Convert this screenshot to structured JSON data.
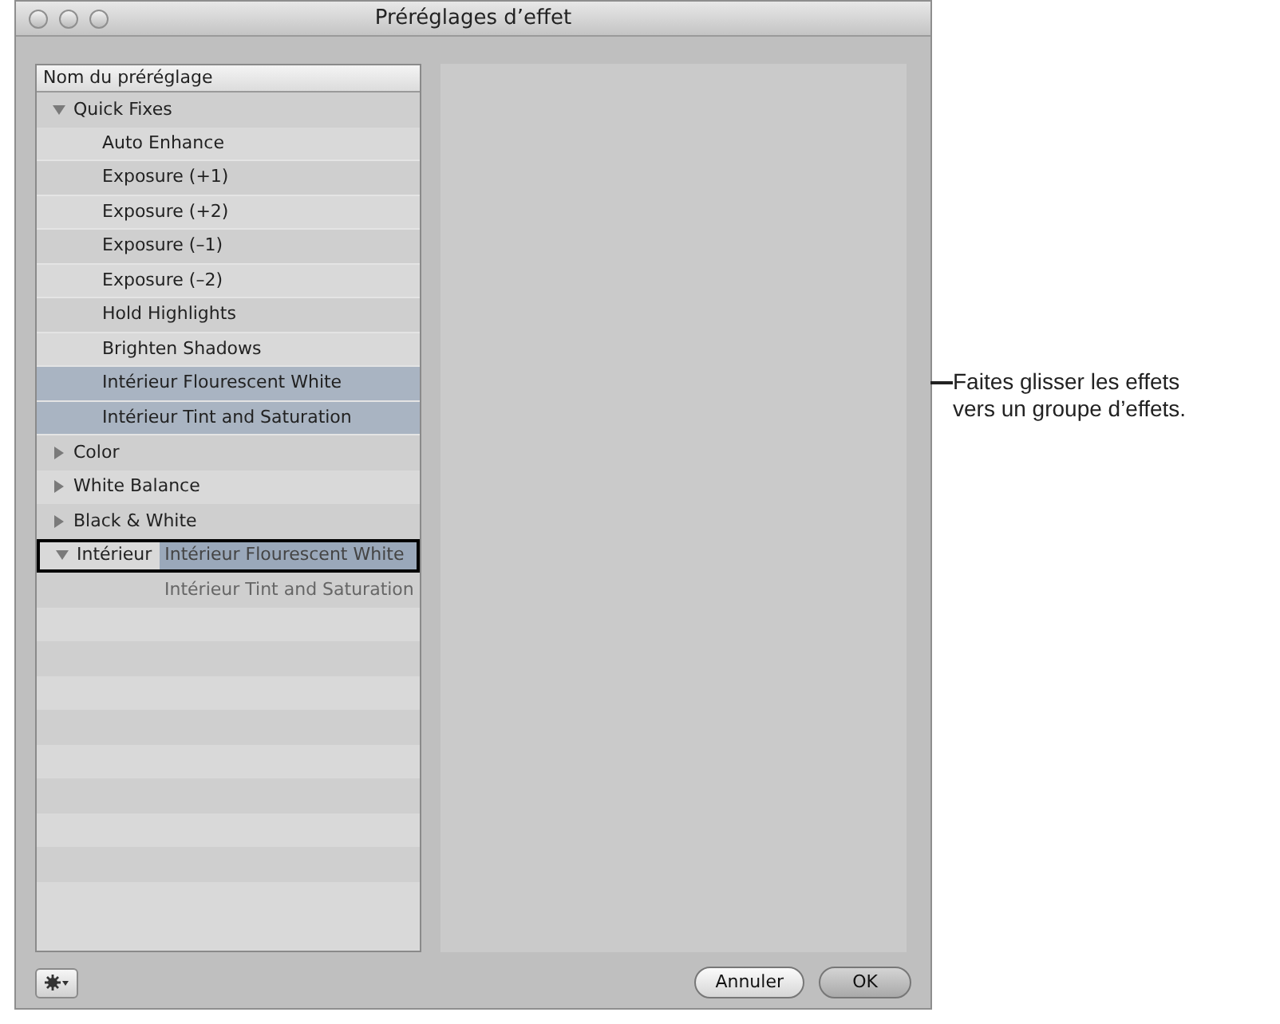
{
  "window": {
    "title": "Préréglages d’effet"
  },
  "list": {
    "header": "Nom du préréglage",
    "rows": [
      {
        "label": "Quick Fixes",
        "expanded": true,
        "drop_target": false,
        "children": [
          {
            "label": "Auto Enhance",
            "selected": false
          },
          {
            "label": "Exposure (+1)",
            "selected": false
          },
          {
            "label": "Exposure (+2)",
            "selected": false
          },
          {
            "label": "Exposure (–1)",
            "selected": false
          },
          {
            "label": "Exposure (–2)",
            "selected": false
          },
          {
            "label": "Hold Highlights",
            "selected": false
          },
          {
            "label": "Brighten Shadows",
            "selected": false
          },
          {
            "label": "Intérieur Flourescent White",
            "selected": true
          },
          {
            "label": "Intérieur Tint and Saturation",
            "selected": true
          }
        ]
      },
      {
        "label": "Color",
        "expanded": false,
        "drop_target": false
      },
      {
        "label": "White Balance",
        "expanded": false,
        "drop_target": false
      },
      {
        "label": "Black & White",
        "expanded": false,
        "drop_target": false
      },
      {
        "label": "Intérieur",
        "expanded": true,
        "drop_target": true,
        "drag_ghost": [
          "Intérieur Flourescent White",
          "Intérieur Tint and Saturation"
        ]
      }
    ]
  },
  "buttons": [
    {
      "label": "Annuler",
      "default": false
    },
    {
      "label": "OK",
      "default": true
    }
  ],
  "callout": {
    "text": "Faites glisser les effets vers un groupe d’effets."
  }
}
